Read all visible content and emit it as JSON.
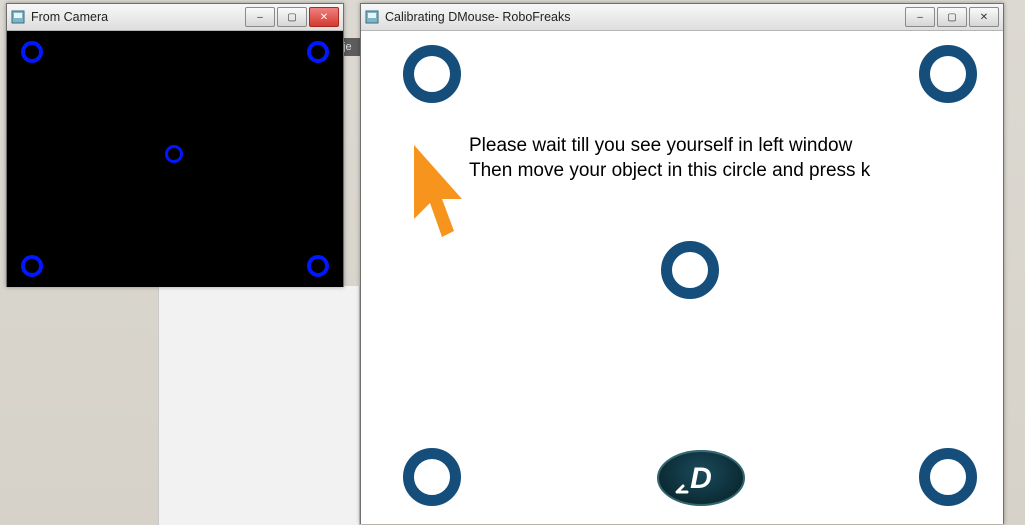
{
  "camera_window": {
    "title": "From Camera",
    "buttons": {
      "min": "–",
      "max": "▢",
      "close": "✕"
    }
  },
  "calibration_window": {
    "title": "Calibrating DMouse- RoboFreaks",
    "buttons": {
      "min": "–",
      "max": "▢",
      "close": "✕"
    },
    "instruction_line1": "Please wait till you see yourself in left window",
    "instruction_line2": "Then move your object in this circle and press k",
    "logo_letter": "D"
  },
  "bg_tab": "oje",
  "colors": {
    "camera_ring": "#0018ff",
    "cal_ring": "#154e7a",
    "cursor": "#f7941d"
  }
}
